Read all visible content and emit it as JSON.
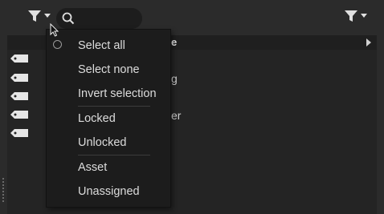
{
  "toolbar": {
    "left_filter_icon": "filter-dropdown-icon",
    "search_icon": "search-icon",
    "search_placeholder": "",
    "right_filter_icon": "filter-dropdown-icon"
  },
  "list": {
    "header_fragment": "e",
    "expand_icon": "chevron-right-icon",
    "rows": [
      {
        "icon": "tag-icon",
        "fragment": ""
      },
      {
        "icon": "tag-icon",
        "fragment": "g"
      },
      {
        "icon": "tag-icon",
        "fragment": ""
      },
      {
        "icon": "tag-icon",
        "fragment": "er"
      },
      {
        "icon": "tag-icon",
        "fragment": ""
      }
    ]
  },
  "menu": {
    "items": [
      {
        "label": "Select all"
      },
      {
        "label": "Select none"
      },
      {
        "label": "Invert selection"
      },
      {
        "label": "Locked"
      },
      {
        "label": "Unlocked"
      },
      {
        "label": "Asset"
      },
      {
        "label": "Unassigned"
      }
    ]
  },
  "colors": {
    "background": "#2b2b2b",
    "panel": "#242424",
    "menu": "#1c1c1c",
    "text": "#dcdcdc"
  }
}
